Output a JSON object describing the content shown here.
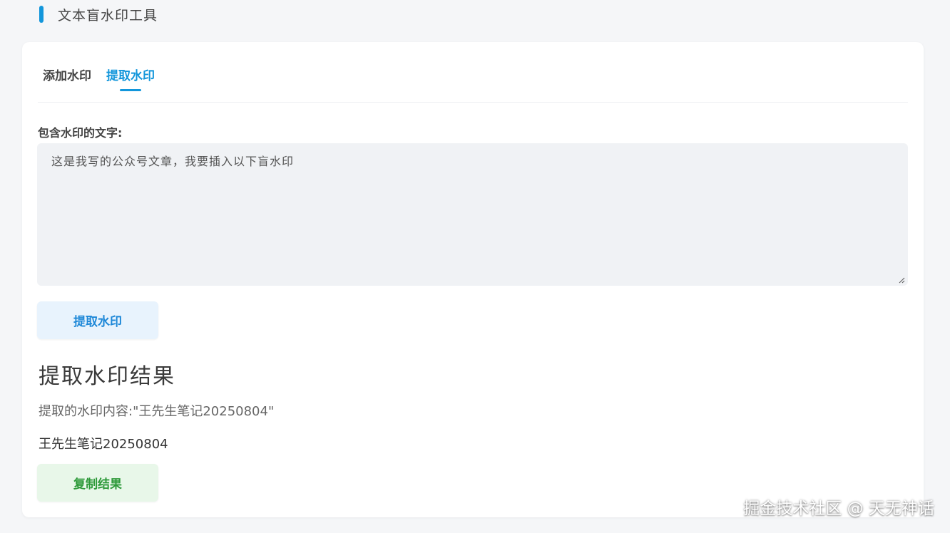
{
  "header": {
    "title": "文本盲水印工具",
    "accent_color": "#1296db"
  },
  "tabs": [
    {
      "label": "添加水印",
      "active": false
    },
    {
      "label": "提取水印",
      "active": true
    }
  ],
  "extract": {
    "field_label": "包含水印的文字:",
    "input_text": "这是我写的公众号文章，我要插入以下盲水印",
    "button_label": "提取水印"
  },
  "result": {
    "title": "提取水印结果",
    "description": "提取的水印内容:\"王先生笔记20250804\"",
    "value": "王先生笔记20250804",
    "copy_button_label": "复制结果"
  },
  "watermark": {
    "text": "掘金技术社区 @ 天无神话"
  },
  "colors": {
    "primary": "#1296db",
    "success": "#2e9a3a",
    "background": "#f5f6f8"
  }
}
